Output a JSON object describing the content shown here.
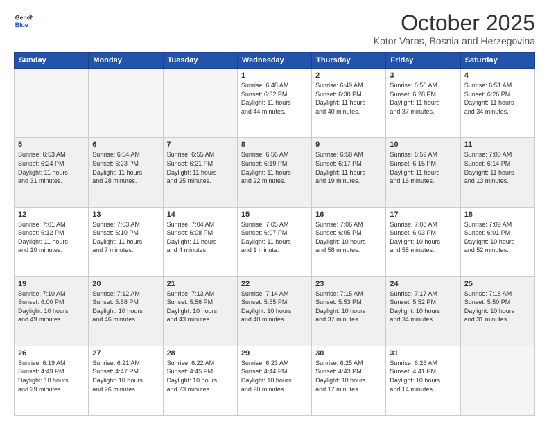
{
  "header": {
    "logo_general": "General",
    "logo_blue": "Blue",
    "month": "October 2025",
    "location": "Kotor Varos, Bosnia and Herzegovina"
  },
  "days_of_week": [
    "Sunday",
    "Monday",
    "Tuesday",
    "Wednesday",
    "Thursday",
    "Friday",
    "Saturday"
  ],
  "weeks": [
    [
      {
        "num": "",
        "info": ""
      },
      {
        "num": "",
        "info": ""
      },
      {
        "num": "",
        "info": ""
      },
      {
        "num": "1",
        "info": "Sunrise: 6:48 AM\nSunset: 6:32 PM\nDaylight: 11 hours\nand 44 minutes."
      },
      {
        "num": "2",
        "info": "Sunrise: 6:49 AM\nSunset: 6:30 PM\nDaylight: 11 hours\nand 40 minutes."
      },
      {
        "num": "3",
        "info": "Sunrise: 6:50 AM\nSunset: 6:28 PM\nDaylight: 11 hours\nand 37 minutes."
      },
      {
        "num": "4",
        "info": "Sunrise: 6:51 AM\nSunset: 6:26 PM\nDaylight: 11 hours\nand 34 minutes."
      }
    ],
    [
      {
        "num": "5",
        "info": "Sunrise: 6:53 AM\nSunset: 6:24 PM\nDaylight: 11 hours\nand 31 minutes."
      },
      {
        "num": "6",
        "info": "Sunrise: 6:54 AM\nSunset: 6:23 PM\nDaylight: 11 hours\nand 28 minutes."
      },
      {
        "num": "7",
        "info": "Sunrise: 6:55 AM\nSunset: 6:21 PM\nDaylight: 11 hours\nand 25 minutes."
      },
      {
        "num": "8",
        "info": "Sunrise: 6:56 AM\nSunset: 6:19 PM\nDaylight: 11 hours\nand 22 minutes."
      },
      {
        "num": "9",
        "info": "Sunrise: 6:58 AM\nSunset: 6:17 PM\nDaylight: 11 hours\nand 19 minutes."
      },
      {
        "num": "10",
        "info": "Sunrise: 6:59 AM\nSunset: 6:15 PM\nDaylight: 11 hours\nand 16 minutes."
      },
      {
        "num": "11",
        "info": "Sunrise: 7:00 AM\nSunset: 6:14 PM\nDaylight: 11 hours\nand 13 minutes."
      }
    ],
    [
      {
        "num": "12",
        "info": "Sunrise: 7:01 AM\nSunset: 6:12 PM\nDaylight: 11 hours\nand 10 minutes."
      },
      {
        "num": "13",
        "info": "Sunrise: 7:03 AM\nSunset: 6:10 PM\nDaylight: 11 hours\nand 7 minutes."
      },
      {
        "num": "14",
        "info": "Sunrise: 7:04 AM\nSunset: 6:08 PM\nDaylight: 11 hours\nand 4 minutes."
      },
      {
        "num": "15",
        "info": "Sunrise: 7:05 AM\nSunset: 6:07 PM\nDaylight: 11 hours\nand 1 minute."
      },
      {
        "num": "16",
        "info": "Sunrise: 7:06 AM\nSunset: 6:05 PM\nDaylight: 10 hours\nand 58 minutes."
      },
      {
        "num": "17",
        "info": "Sunrise: 7:08 AM\nSunset: 6:03 PM\nDaylight: 10 hours\nand 55 minutes."
      },
      {
        "num": "18",
        "info": "Sunrise: 7:09 AM\nSunset: 6:01 PM\nDaylight: 10 hours\nand 52 minutes."
      }
    ],
    [
      {
        "num": "19",
        "info": "Sunrise: 7:10 AM\nSunset: 6:00 PM\nDaylight: 10 hours\nand 49 minutes."
      },
      {
        "num": "20",
        "info": "Sunrise: 7:12 AM\nSunset: 5:58 PM\nDaylight: 10 hours\nand 46 minutes."
      },
      {
        "num": "21",
        "info": "Sunrise: 7:13 AM\nSunset: 5:56 PM\nDaylight: 10 hours\nand 43 minutes."
      },
      {
        "num": "22",
        "info": "Sunrise: 7:14 AM\nSunset: 5:55 PM\nDaylight: 10 hours\nand 40 minutes."
      },
      {
        "num": "23",
        "info": "Sunrise: 7:15 AM\nSunset: 5:53 PM\nDaylight: 10 hours\nand 37 minutes."
      },
      {
        "num": "24",
        "info": "Sunrise: 7:17 AM\nSunset: 5:52 PM\nDaylight: 10 hours\nand 34 minutes."
      },
      {
        "num": "25",
        "info": "Sunrise: 7:18 AM\nSunset: 5:50 PM\nDaylight: 10 hours\nand 31 minutes."
      }
    ],
    [
      {
        "num": "26",
        "info": "Sunrise: 6:19 AM\nSunset: 4:49 PM\nDaylight: 10 hours\nand 29 minutes."
      },
      {
        "num": "27",
        "info": "Sunrise: 6:21 AM\nSunset: 4:47 PM\nDaylight: 10 hours\nand 26 minutes."
      },
      {
        "num": "28",
        "info": "Sunrise: 6:22 AM\nSunset: 4:45 PM\nDaylight: 10 hours\nand 23 minutes."
      },
      {
        "num": "29",
        "info": "Sunrise: 6:23 AM\nSunset: 4:44 PM\nDaylight: 10 hours\nand 20 minutes."
      },
      {
        "num": "30",
        "info": "Sunrise: 6:25 AM\nSunset: 4:43 PM\nDaylight: 10 hours\nand 17 minutes."
      },
      {
        "num": "31",
        "info": "Sunrise: 6:26 AM\nSunset: 4:41 PM\nDaylight: 10 hours\nand 14 minutes."
      },
      {
        "num": "",
        "info": ""
      }
    ]
  ]
}
